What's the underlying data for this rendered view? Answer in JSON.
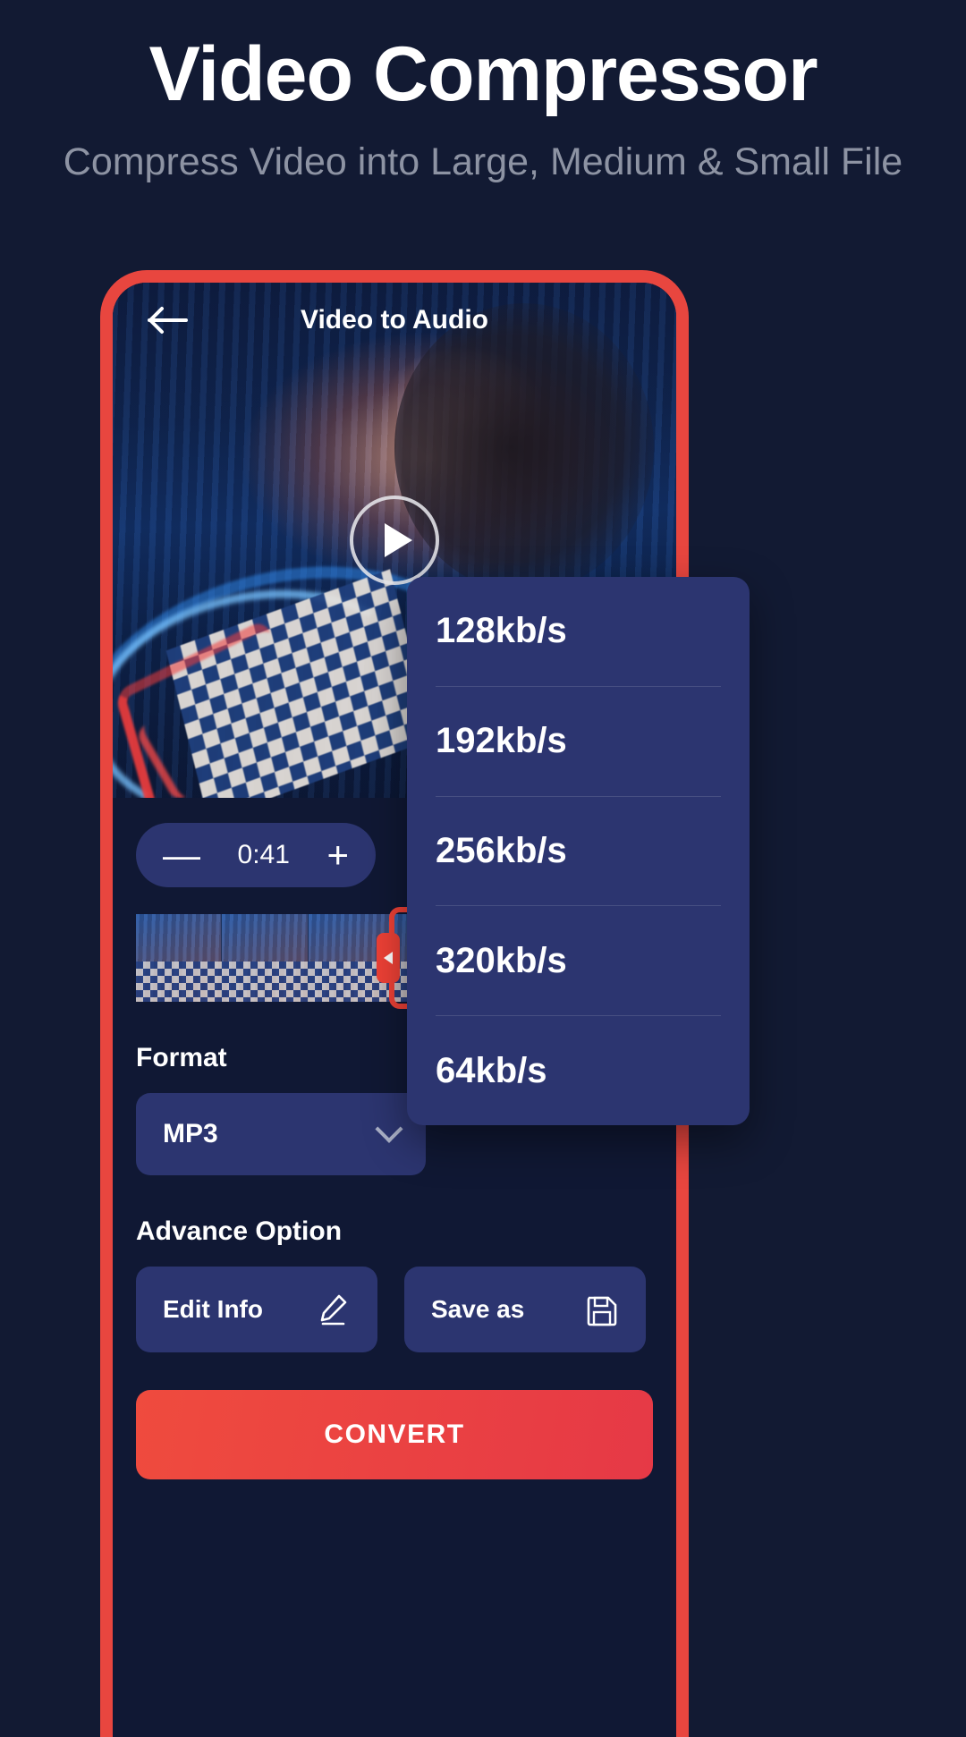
{
  "promo": {
    "title": "Video Compressor",
    "subtitle": "Compress Video into Large,\nMedium & Small File"
  },
  "app": {
    "title": "Video to Audio",
    "back_icon": "arrow-left-icon",
    "player": {
      "play_icon": "play-icon"
    },
    "trim": {
      "minus_label": "—",
      "value": "0:41",
      "plus_label": "+",
      "duration": "0:41"
    },
    "format": {
      "label": "Format",
      "value": "MP3",
      "chevron_icon": "chevron-down-icon"
    },
    "advance": {
      "label": "Advance Option",
      "edit_info_label": "Edit Info",
      "edit_info_icon": "pencil-icon",
      "save_as_label": "Save as",
      "save_as_icon": "floppy-disk-icon"
    },
    "convert_label": "CONVERT"
  },
  "bitrate_dropdown": {
    "options": [
      "128kb/s",
      "192kb/s",
      "256kb/s",
      "320kb/s",
      "64kb/s"
    ]
  },
  "colors": {
    "background": "#121a33",
    "accent_red": "#ef4136",
    "panel_blue": "#2c3570",
    "subtitle_grey": "#8d93a3"
  }
}
